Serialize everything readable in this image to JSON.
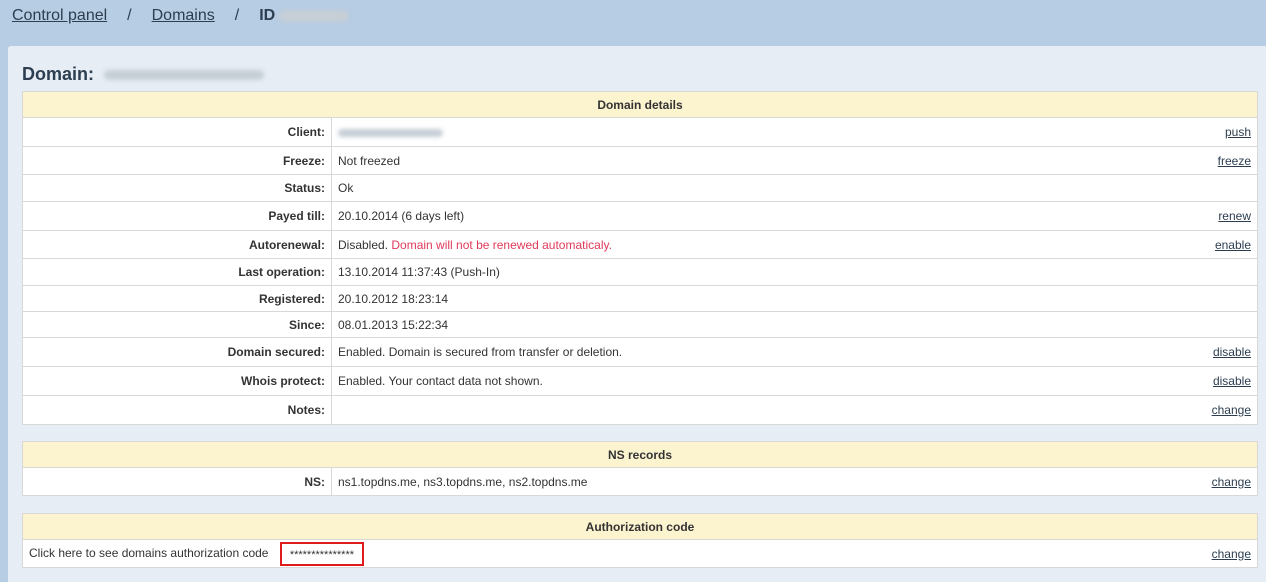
{
  "breadcrumb": {
    "control_panel": "Control panel",
    "sep1": "/",
    "domains": "Domains",
    "sep2": "/",
    "current": "ID"
  },
  "page": {
    "title": "Domain:"
  },
  "details": {
    "header": "Domain details",
    "rows": [
      {
        "label": "Client:",
        "value": "",
        "action": "push"
      },
      {
        "label": "Freeze:",
        "value": "Not freezed",
        "action": "freeze"
      },
      {
        "label": "Status:",
        "value": "Ok",
        "action": ""
      },
      {
        "label": "Payed till:",
        "value": "20.10.2014 (6 days left)",
        "action": "renew"
      },
      {
        "label": "Autorenewal:",
        "value": "Disabled.",
        "warning": "Domain will not be renewed automaticaly.",
        "action": "enable"
      },
      {
        "label": "Last operation:",
        "value": "13.10.2014 11:37:43 (Push-In)",
        "action": ""
      },
      {
        "label": "Registered:",
        "value": "20.10.2012 18:23:14",
        "action": ""
      },
      {
        "label": "Since:",
        "value": "08.01.2013 15:22:34",
        "action": ""
      },
      {
        "label": "Domain secured:",
        "value": "Enabled. Domain is secured from transfer or deletion.",
        "action": "disable"
      },
      {
        "label": "Whois protect:",
        "value": "Enabled. Your contact data not shown.",
        "action": "disable"
      },
      {
        "label": "Notes:",
        "value": "",
        "action": "change"
      }
    ]
  },
  "ns": {
    "header": "NS records",
    "label": "NS:",
    "value": "ns1.topdns.me, ns3.topdns.me, ns2.topdns.me",
    "action": "change"
  },
  "auth": {
    "header": "Authorization code",
    "text": "Click here to see domains authorization code",
    "masked": "***************",
    "action": "change"
  }
}
